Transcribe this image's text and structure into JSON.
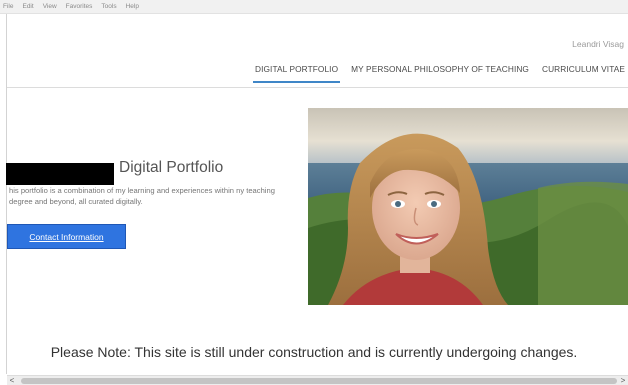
{
  "browser": {
    "menu": [
      "File",
      "Edit",
      "View",
      "Favorites",
      "Tools",
      "Help"
    ]
  },
  "site": {
    "owner_name": "Leandri Visag"
  },
  "nav": {
    "tabs": [
      {
        "label": "DIGITAL PORTFOLIO",
        "active": true
      },
      {
        "label": "MY PERSONAL PHILOSOPHY OF TEACHING",
        "active": false
      },
      {
        "label": "CURRICULUM VITAE (CV",
        "active": false
      }
    ],
    "accent_color": "#3f86c7"
  },
  "hero": {
    "title": "Digital Portfolio",
    "description": "his portfolio is a combination of my learning and experiences within ny teaching degree and beyond, all curated digitally.",
    "contact_button": "Contact Information",
    "button_color": "#2f74e0"
  },
  "notice": {
    "text": "Please Note: This site is still under construction and is currently undergoing changes."
  },
  "scrollbar": {
    "left_arrow": "<",
    "right_arrow": ">"
  }
}
